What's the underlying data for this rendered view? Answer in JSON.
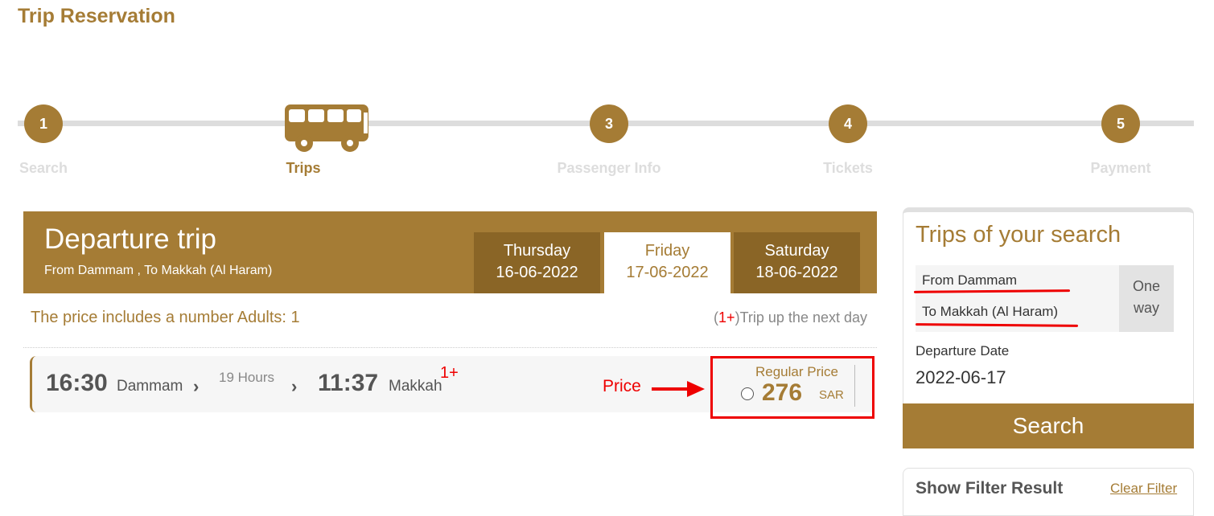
{
  "page": {
    "title": "Trip Reservation"
  },
  "steps": [
    {
      "number": "1",
      "label": "Search"
    },
    {
      "number": "",
      "label": "Trips"
    },
    {
      "number": "3",
      "label": "Passenger Info"
    },
    {
      "number": "4",
      "label": "Tickets"
    },
    {
      "number": "5",
      "label": "Payment"
    }
  ],
  "departure": {
    "title": "Departure trip",
    "route": "From Dammam , To Makkah (Al Haram)",
    "days": [
      {
        "day": "Thursday",
        "date": "16-06-2022"
      },
      {
        "day": "Friday",
        "date": "17-06-2022"
      },
      {
        "day": "Saturday",
        "date": "18-06-2022"
      }
    ]
  },
  "price_note": "The price includes a number Adults: 1",
  "next_day_note": {
    "open": "(",
    "marker": "1+",
    "text": ")Trip up the next day"
  },
  "trip": {
    "depart_time": "16:30",
    "from_city": "Dammam",
    "duration": "19 Hours",
    "arrive_time": "11:37",
    "to_city": "Makkah",
    "next_day": "1+",
    "price_label": "Regular Price",
    "price": "276",
    "currency": "SAR"
  },
  "annotation": {
    "price": "Price"
  },
  "sidebar": {
    "title": "Trips of your search",
    "from": "From Dammam",
    "to": "To Makkah (Al Haram)",
    "trip_type_line1": "One",
    "trip_type_line2": "way",
    "departure_date_label": "Departure Date",
    "departure_date": "2022-06-17",
    "search_button": "Search"
  },
  "filter": {
    "title": "Show Filter Result",
    "clear": "Clear Filter"
  },
  "colors": {
    "brand": "#a57c35",
    "brand_dark": "#8a6526",
    "annotation_red": "#e00000"
  }
}
